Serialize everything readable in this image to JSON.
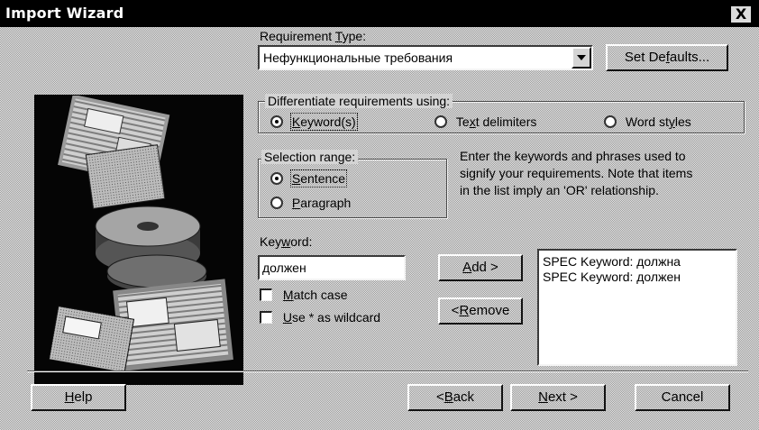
{
  "window": {
    "title": "Import Wizard",
    "close_label": "X"
  },
  "requirement_type": {
    "label_pre": "Requirement ",
    "label_u": "T",
    "label_post": "ype:",
    "value": "Нефункциональные требования",
    "set_defaults_pre": "Set De",
    "set_defaults_u": "f",
    "set_defaults_post": "aults..."
  },
  "differentiate": {
    "title": "Differentiate requirements using:",
    "options": [
      {
        "pre": "",
        "u": "K",
        "post": "eyword(s)",
        "selected": true
      },
      {
        "pre": "Te",
        "u": "x",
        "post": "t delimiters",
        "selected": false
      },
      {
        "pre": "Word st",
        "u": "y",
        "post": "les",
        "selected": false
      }
    ]
  },
  "selection_range": {
    "title": "Selection range:",
    "options": [
      {
        "pre": "",
        "u": "S",
        "post": "entence",
        "selected": true
      },
      {
        "pre": "",
        "u": "P",
        "post": "aragraph",
        "selected": false
      }
    ]
  },
  "help_text_lines": [
    "Enter the keywords and phrases used to",
    "signify your requirements. Note that items",
    "in the list imply an 'OR' relationship."
  ],
  "keyword": {
    "label_pre": "Key",
    "label_u": "w",
    "label_post": "ord:",
    "value": "должен",
    "match_case": {
      "pre": "",
      "u": "M",
      "post": "atch case",
      "checked": false
    },
    "wildcard": {
      "pre": "",
      "u": "U",
      "post": "se * as wildcard",
      "checked": false
    },
    "add": {
      "pre": "",
      "u": "A",
      "post": "dd >"
    },
    "remove": {
      "pre": "< ",
      "u": "R",
      "post": "emove"
    }
  },
  "keyword_list": [
    "SPEC Keyword: должна",
    "SPEC Keyword: должен"
  ],
  "footer": {
    "help": {
      "pre": "",
      "u": "H",
      "post": "elp"
    },
    "back": {
      "pre": "< ",
      "u": "B",
      "post": "ack"
    },
    "next": {
      "pre": "",
      "u": "N",
      "post": "ext >"
    },
    "cancel": {
      "label": "Cancel"
    }
  }
}
